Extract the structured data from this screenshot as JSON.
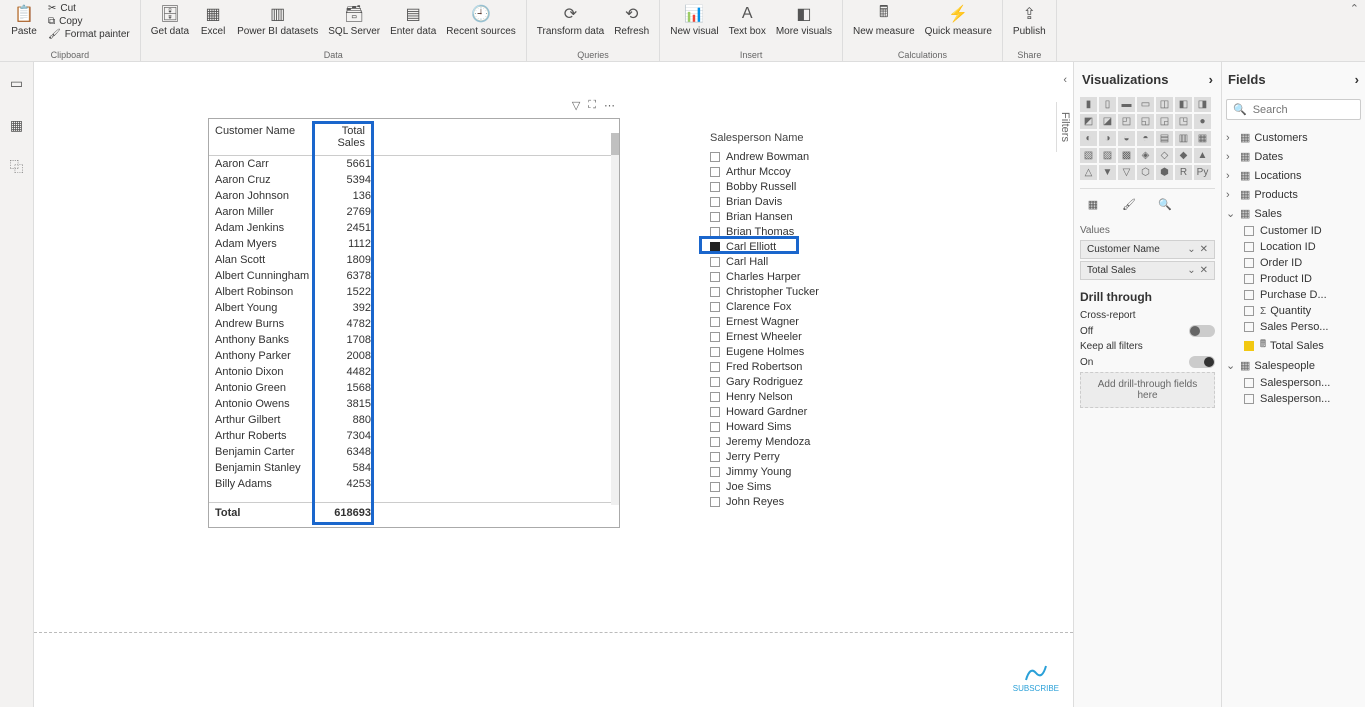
{
  "ribbon": {
    "clipboard": {
      "label": "Clipboard",
      "paste": "Paste",
      "cut": "Cut",
      "copy": "Copy",
      "format_painter": "Format painter"
    },
    "data": {
      "label": "Data",
      "get_data": "Get data",
      "excel": "Excel",
      "pbi_datasets": "Power BI datasets",
      "sql_server": "SQL Server",
      "enter_data": "Enter data",
      "recent_sources": "Recent sources"
    },
    "queries": {
      "label": "Queries",
      "transform_data": "Transform data",
      "refresh": "Refresh"
    },
    "insert": {
      "label": "Insert",
      "new_visual": "New visual",
      "text_box": "Text box",
      "more_visuals": "More visuals"
    },
    "calculations": {
      "label": "Calculations",
      "new_measure": "New measure",
      "quick_measure": "Quick measure"
    },
    "share": {
      "label": "Share",
      "publish": "Publish"
    }
  },
  "table": {
    "header_customer": "Customer Name",
    "header_total": "Total Sales",
    "rows": [
      {
        "name": "Aaron Carr",
        "val": "5661"
      },
      {
        "name": "Aaron Cruz",
        "val": "5394"
      },
      {
        "name": "Aaron Johnson",
        "val": "136"
      },
      {
        "name": "Aaron Miller",
        "val": "2769"
      },
      {
        "name": "Adam Jenkins",
        "val": "2451"
      },
      {
        "name": "Adam Myers",
        "val": "1112"
      },
      {
        "name": "Alan Scott",
        "val": "1809"
      },
      {
        "name": "Albert Cunningham",
        "val": "6378"
      },
      {
        "name": "Albert Robinson",
        "val": "1522"
      },
      {
        "name": "Albert Young",
        "val": "392"
      },
      {
        "name": "Andrew Burns",
        "val": "4782"
      },
      {
        "name": "Anthony Banks",
        "val": "1708"
      },
      {
        "name": "Anthony Parker",
        "val": "2008"
      },
      {
        "name": "Antonio Dixon",
        "val": "4482"
      },
      {
        "name": "Antonio Green",
        "val": "1568"
      },
      {
        "name": "Antonio Owens",
        "val": "3815"
      },
      {
        "name": "Arthur Gilbert",
        "val": "880"
      },
      {
        "name": "Arthur Roberts",
        "val": "7304"
      },
      {
        "name": "Benjamin Carter",
        "val": "6348"
      },
      {
        "name": "Benjamin Stanley",
        "val": "584"
      },
      {
        "name": "Billy Adams",
        "val": "4253"
      }
    ],
    "total_label": "Total",
    "total_value": "618693"
  },
  "slicer": {
    "title": "Salesperson Name",
    "items": [
      "Andrew Bowman",
      "Arthur Mccoy",
      "Bobby Russell",
      "Brian Davis",
      "Brian Hansen",
      "Brian Thomas",
      "Carl Elliott",
      "Carl Hall",
      "Charles Harper",
      "Christopher Tucker",
      "Clarence Fox",
      "Ernest Wagner",
      "Ernest Wheeler",
      "Eugene Holmes",
      "Fred Robertson",
      "Gary Rodriguez",
      "Henry Nelson",
      "Howard Gardner",
      "Howard Sims",
      "Jeremy Mendoza",
      "Jerry Perry",
      "Jimmy Young",
      "Joe Sims",
      "John Reyes"
    ],
    "selected_index": 6
  },
  "filters_label": "Filters",
  "viz": {
    "title": "Visualizations",
    "values_label": "Values",
    "wells": [
      "Customer Name",
      "Total Sales"
    ],
    "drill_title": "Drill through",
    "cross_report": "Cross-report",
    "off": "Off",
    "keep_filters": "Keep all filters",
    "on": "On",
    "drill_target": "Add drill-through fields here"
  },
  "fields": {
    "title": "Fields",
    "search_ph": "Search",
    "tables": [
      {
        "name": "Customers",
        "expanded": false
      },
      {
        "name": "Dates",
        "expanded": false
      },
      {
        "name": "Locations",
        "expanded": false
      },
      {
        "name": "Products",
        "expanded": false
      },
      {
        "name": "Sales",
        "expanded": true,
        "items": [
          {
            "name": "Customer ID",
            "checked": false
          },
          {
            "name": "Location ID",
            "checked": false
          },
          {
            "name": "Order ID",
            "checked": false
          },
          {
            "name": "Product ID",
            "checked": false
          },
          {
            "name": "Purchase D...",
            "checked": false
          },
          {
            "name": "Quantity",
            "checked": false,
            "sigma": true
          },
          {
            "name": "Sales Perso...",
            "checked": false
          },
          {
            "name": "Total Sales",
            "checked": true,
            "sigma": false,
            "calc": true
          }
        ]
      },
      {
        "name": "Salespeople",
        "expanded": true,
        "items": [
          {
            "name": "Salesperson...",
            "checked": false
          },
          {
            "name": "Salesperson...",
            "checked": false
          }
        ]
      }
    ]
  },
  "brand": "SUBSCRIBE"
}
